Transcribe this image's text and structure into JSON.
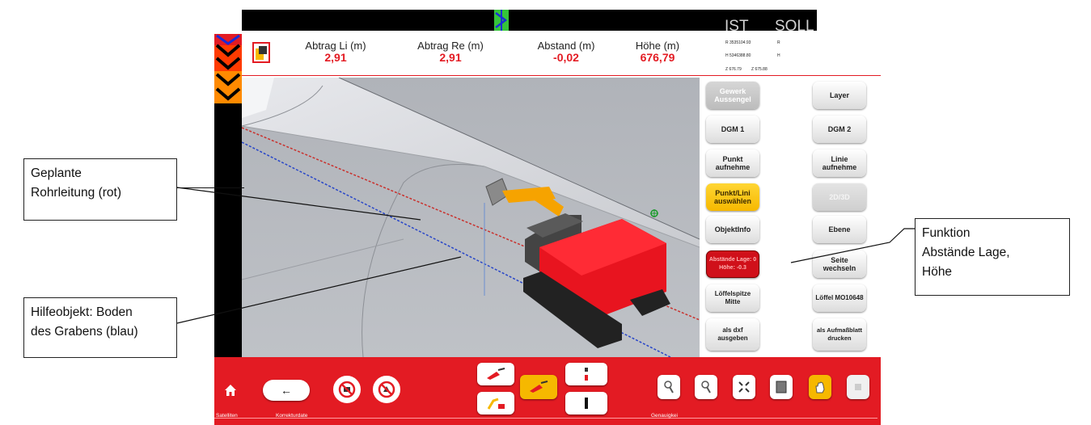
{
  "annotations": {
    "pipe": {
      "line1": "Geplante",
      "line2": "Rohrleitung (rot)"
    },
    "ditch": {
      "line1": "Hilfeobjekt: Boden",
      "line2": "des Grabens (blau)"
    },
    "function": {
      "line1": "Funktion",
      "line2": "Abstände Lage,",
      "line3": "Höhe"
    }
  },
  "header": {
    "ist": "IST",
    "soll": "SOLL",
    "readouts": [
      {
        "label": "Abtrag Li (m)",
        "value": "2,91"
      },
      {
        "label": "Abtrag Re (m)",
        "value": "2,91"
      },
      {
        "label": "Abstand (m)",
        "value": "-0,02"
      },
      {
        "label": "Höhe (m)",
        "value": "676,79"
      }
    ],
    "coords": {
      "r_ist": "R 3535104.93",
      "r_soll": "R",
      "h_ist": "H 5346388.80",
      "h_soll": "H",
      "z_ist": "Z 676.79",
      "z_soll": "Z 675.88"
    }
  },
  "panel": {
    "gewerk": "Gewerk Aussengel",
    "layer": "Layer",
    "dgm1": "DGM 1",
    "dgm2": "DGM 2",
    "punkt_auf": "Punkt aufnehme",
    "linie_auf": "Linie aufnehme",
    "punkt_linie": "Punkt/Lini auswählen",
    "d2d3": "2D/3D",
    "objektinfo": "ObjektInfo",
    "ebene": "Ebene",
    "abstaende": "Abstände Lage: 0 Höhe: -0.3",
    "seite": "Seite wechseln",
    "loeffelspitze": "Löffelspitze Mitte",
    "loeffel": "Löffel MO10648",
    "dxf": "als dxf ausgeben",
    "aufmass": "als Aufmaßblatt drucken"
  },
  "bottom": {
    "back_arrow": "←",
    "satelliten": "Satelliten",
    "korrektur": "Korrekturdate",
    "genauigkeit": "Genauigkei"
  },
  "colors": {
    "brand_red": "#e31b23",
    "accent_yellow": "#f6b800"
  }
}
